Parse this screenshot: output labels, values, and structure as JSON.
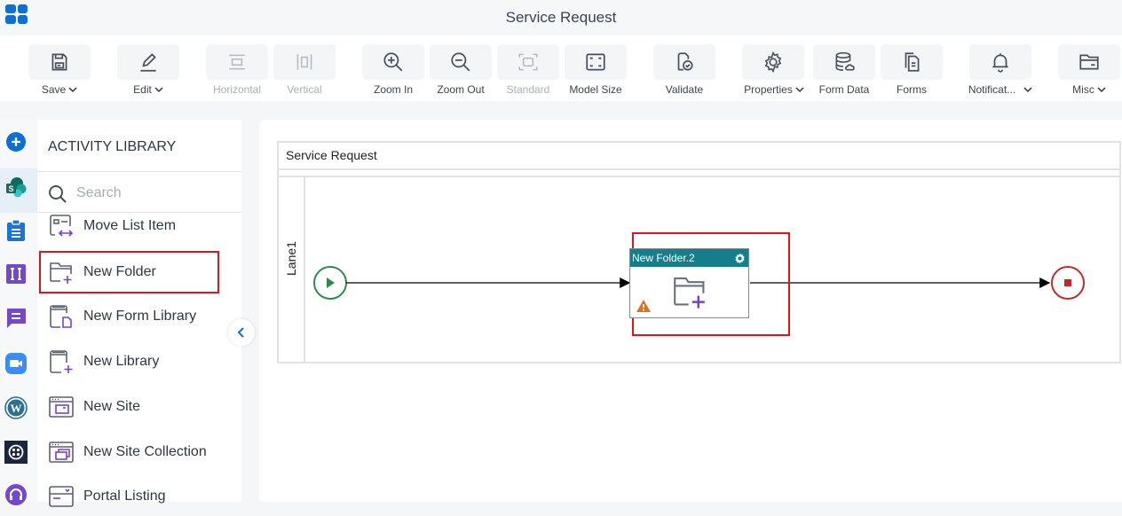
{
  "header": {
    "title": "Service Request",
    "app_launcher_icon": "app-grid-icon"
  },
  "toolbar": {
    "items": [
      {
        "label": "Save",
        "icon": "save-icon",
        "dropdown": true,
        "disabled": false
      },
      {
        "label": "Edit",
        "icon": "edit-icon",
        "dropdown": true,
        "disabled": false
      },
      {
        "label": "Horizontal",
        "icon": "horizontal-icon",
        "dropdown": false,
        "disabled": true
      },
      {
        "label": "Vertical",
        "icon": "vertical-icon",
        "dropdown": false,
        "disabled": true
      },
      {
        "label": "Zoom In",
        "icon": "zoom-in-icon",
        "dropdown": false,
        "disabled": false
      },
      {
        "label": "Zoom Out",
        "icon": "zoom-out-icon",
        "dropdown": false,
        "disabled": false
      },
      {
        "label": "Standard",
        "icon": "standard-icon",
        "dropdown": false,
        "disabled": true
      },
      {
        "label": "Model Size",
        "icon": "model-size-icon",
        "dropdown": false,
        "disabled": false
      },
      {
        "label": "Validate",
        "icon": "validate-icon",
        "dropdown": false,
        "disabled": false
      },
      {
        "label": "Properties",
        "icon": "gear-icon",
        "dropdown": true,
        "disabled": false
      },
      {
        "label": "Form Data",
        "icon": "database-icon",
        "dropdown": false,
        "disabled": false
      },
      {
        "label": "Forms",
        "icon": "forms-icon",
        "dropdown": false,
        "disabled": false
      },
      {
        "label": "Notificat...",
        "icon": "bell-icon",
        "dropdown": true,
        "disabled": false
      },
      {
        "label": "Misc",
        "icon": "folder-icon",
        "dropdown": true,
        "disabled": false
      }
    ]
  },
  "leftbar": {
    "items": [
      {
        "name": "add",
        "icon": "plus-circle-icon",
        "color": "#0c6fd8"
      },
      {
        "name": "sharepoint",
        "icon": "sharepoint-icon",
        "color": "#0b7a6e",
        "active": true
      },
      {
        "name": "clipboard",
        "icon": "clipboard-icon",
        "color": "#1a74d4"
      },
      {
        "name": "integration",
        "icon": "ii-icon",
        "color": "#7348c9"
      },
      {
        "name": "chat",
        "icon": "chat-icon",
        "color": "#7348c9"
      },
      {
        "name": "zoom",
        "icon": "video-icon",
        "color": "#3b8cf5"
      },
      {
        "name": "wordpress",
        "icon": "wordpress-icon",
        "color": "#2a6f94"
      },
      {
        "name": "twilio",
        "icon": "twilio-icon",
        "color": "#1c2540"
      },
      {
        "name": "support",
        "icon": "headset-icon",
        "color": "#7348c9"
      }
    ]
  },
  "library": {
    "title": "ACTIVITY LIBRARY",
    "search_placeholder": "Search",
    "search_value": "",
    "items": [
      {
        "label": "Move List Item",
        "icon": "move-list-item-icon"
      },
      {
        "label": "New Folder",
        "icon": "new-folder-icon",
        "highlighted": true
      },
      {
        "label": "New Form Library",
        "icon": "new-form-library-icon"
      },
      {
        "label": "New Library",
        "icon": "new-library-icon"
      },
      {
        "label": "New Site",
        "icon": "new-site-icon"
      },
      {
        "label": "New Site Collection",
        "icon": "new-site-collection-icon"
      },
      {
        "label": "Portal Listing",
        "icon": "portal-listing-icon"
      }
    ]
  },
  "canvas": {
    "pool_title": "Service Request",
    "lane_label": "Lane1",
    "task": {
      "title": "New Folder.2",
      "has_warning": true,
      "header_color": "#147e8a"
    },
    "selection_color": "#e0141b",
    "start_color": "#2e8b47",
    "end_color": "#c62828"
  }
}
